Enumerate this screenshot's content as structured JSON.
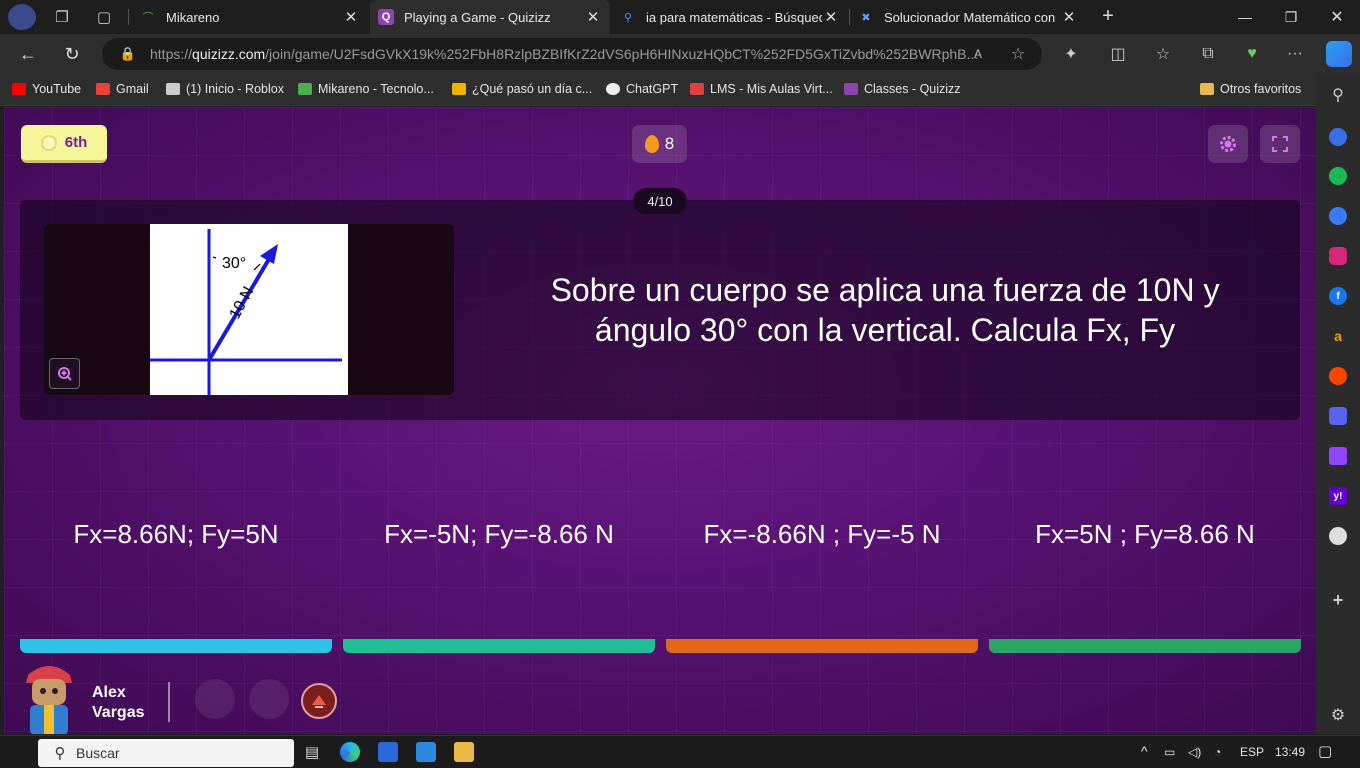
{
  "browser": {
    "tabs": [
      {
        "label": "Mikareno",
        "active": false
      },
      {
        "label": "Playing a Game - Quizizz",
        "active": true
      },
      {
        "label": "ia para matemáticas - Búsqueda",
        "active": false
      },
      {
        "label": "Solucionador Matemático con IA",
        "active": false
      }
    ],
    "new_tab": "+",
    "url_prefix": "https://",
    "url_host": "quizizz.com",
    "url_path": "/join/game/U2FsdGVkX19k%252FbH8RzlpBZBIfKrZ2dVS6pH6HINxuzHQbCT%252FD5GxTiZvbd%252BWRphB...",
    "bookmarks": [
      {
        "label": "YouTube",
        "color": "#ff0000"
      },
      {
        "label": "Gmail",
        "color": "#ea4335"
      },
      {
        "label": "(1) Inicio - Roblox",
        "color": "#cccccc"
      },
      {
        "label": "Mikareno - Tecnolo...",
        "color": "#4caf50"
      },
      {
        "label": "¿Qué pasó un día c...",
        "color": "#f0b400"
      },
      {
        "label": "ChatGPT",
        "color": "#eeeeee"
      },
      {
        "label": "LMS - Mis Aulas Virt...",
        "color": "#e04040"
      },
      {
        "label": "Classes - Quizizz",
        "color": "#8e44ad"
      }
    ],
    "other_favorites": "Otros favoritos"
  },
  "game": {
    "rank": "6th",
    "streak": "8",
    "question_counter": "4/10",
    "question": "Sobre un cuerpo se aplica una fuerza de 10N y ángulo 30° con la vertical. Calcula Fx, Fy",
    "diagram": {
      "angle_label": "30°",
      "force_label": "10 N"
    },
    "options": [
      {
        "text": "Fx=8.66N; Fy=5N",
        "color": "#2bc3e6"
      },
      {
        "text": "Fx=-5N; Fy=-8.66 N",
        "color": "#1fbf94"
      },
      {
        "text": "Fx=-8.66N ; Fy=-5 N",
        "color": "#e06a1a"
      },
      {
        "text": "Fx=5N ; Fy=8.66 N",
        "color": "#2aa565"
      }
    ],
    "player": {
      "first": "Alex",
      "last": "Vargas"
    }
  },
  "taskbar": {
    "search_placeholder": "Buscar",
    "lang": "ESP",
    "time": "13:49"
  }
}
